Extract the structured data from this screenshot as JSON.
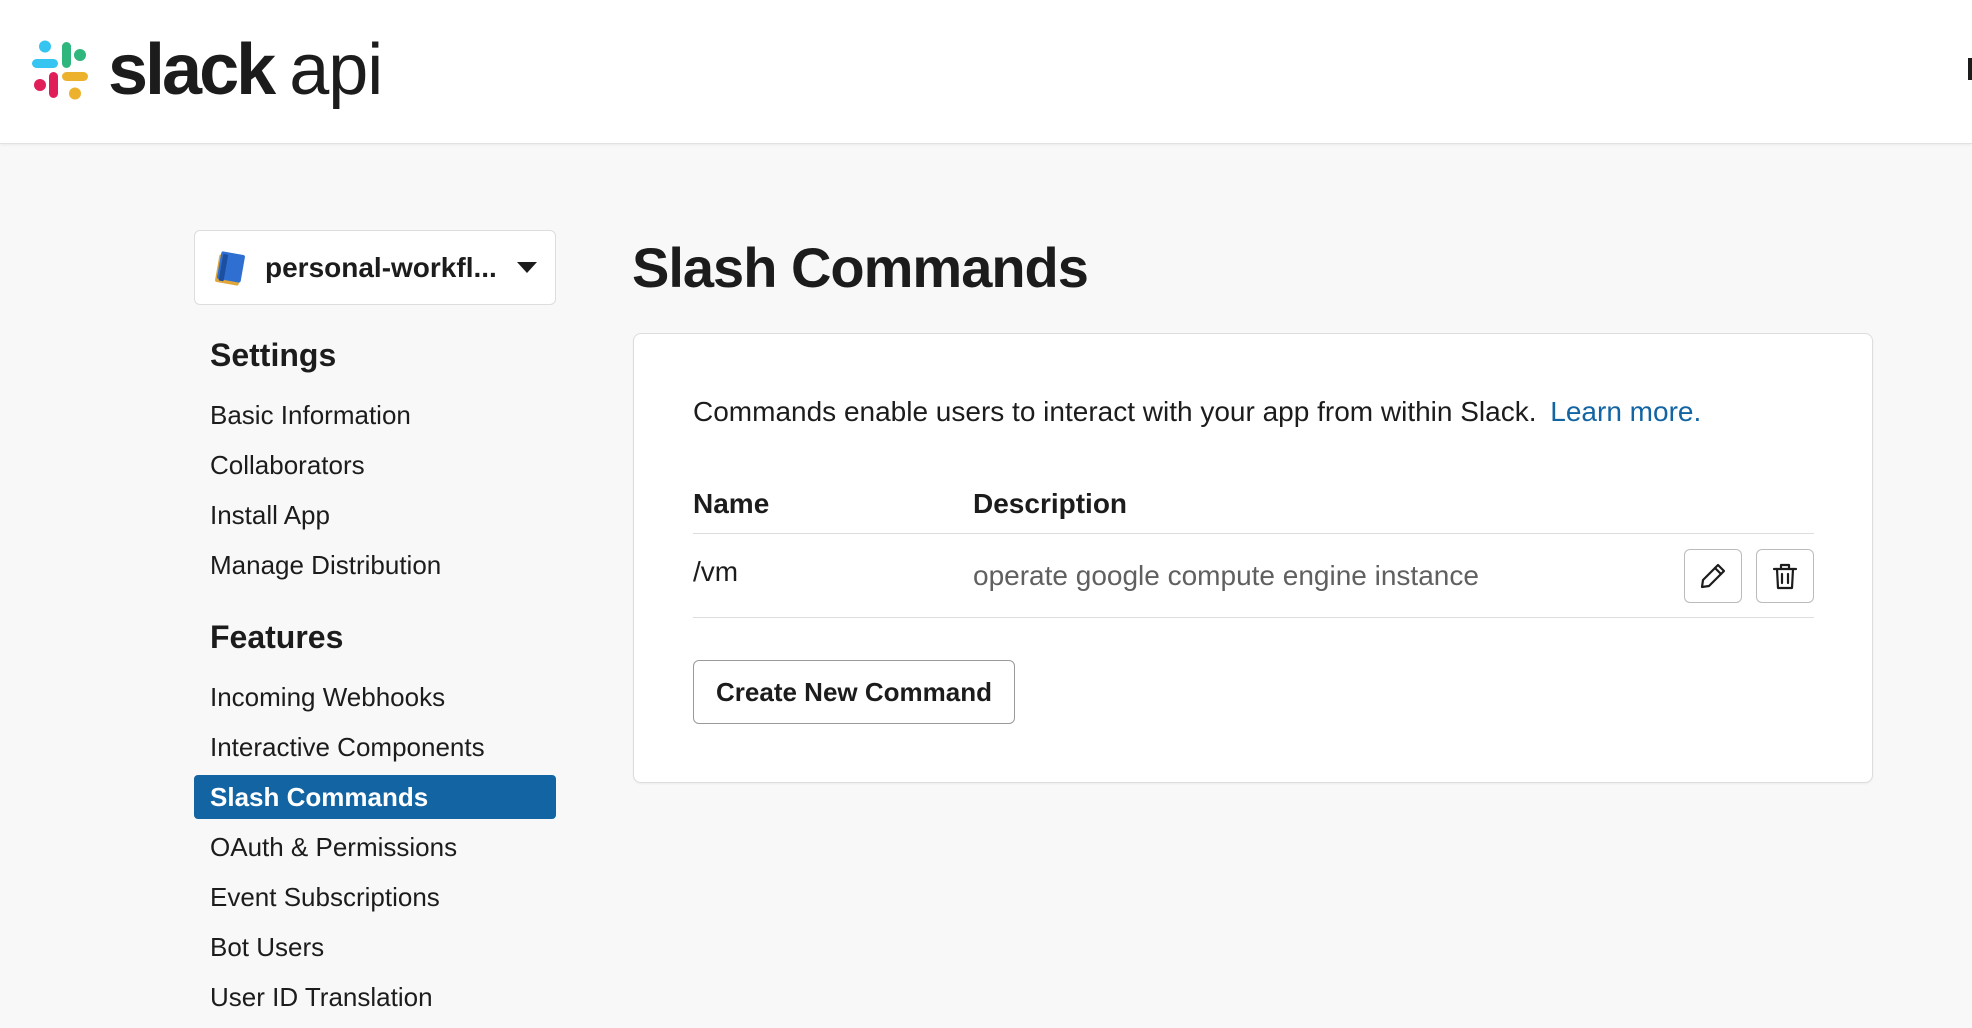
{
  "header": {
    "logo_slack": "slack",
    "logo_api": "api",
    "logo_icon": "slack-hash-logo-icon"
  },
  "sidebar": {
    "app_selector": {
      "name": "personal-workfl...",
      "icon": "notebook-icon",
      "caret_icon": "caret-down-icon"
    },
    "sections": [
      {
        "heading": "Settings",
        "items": [
          {
            "label": "Basic Information",
            "active": false
          },
          {
            "label": "Collaborators",
            "active": false
          },
          {
            "label": "Install App",
            "active": false
          },
          {
            "label": "Manage Distribution",
            "active": false
          }
        ]
      },
      {
        "heading": "Features",
        "items": [
          {
            "label": "Incoming Webhooks",
            "active": false
          },
          {
            "label": "Interactive Components",
            "active": false
          },
          {
            "label": "Slash Commands",
            "active": true
          },
          {
            "label": "OAuth & Permissions",
            "active": false
          },
          {
            "label": "Event Subscriptions",
            "active": false
          },
          {
            "label": "Bot Users",
            "active": false
          },
          {
            "label": "User ID Translation",
            "active": false
          }
        ]
      }
    ]
  },
  "main": {
    "title": "Slash Commands",
    "intro_text": "Commands enable users to interact with your app from within Slack.",
    "learn_more": "Learn more.",
    "table": {
      "columns": [
        "Name",
        "Description"
      ],
      "rows": [
        {
          "name": "/vm",
          "description": "operate google compute engine instance",
          "edit_icon": "pencil-icon",
          "delete_icon": "trash-icon"
        }
      ]
    },
    "create_button": "Create New Command"
  },
  "colors": {
    "accent": "#1264a3",
    "text": "#1d1c1d",
    "muted_text": "#616061",
    "background": "#f8f8f8",
    "card": "#ffffff",
    "border": "#dddddd"
  }
}
